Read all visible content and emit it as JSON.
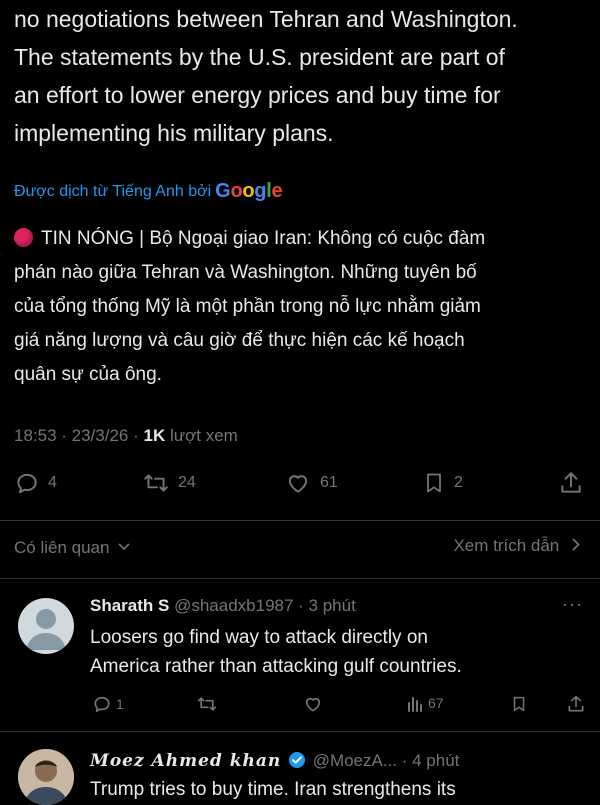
{
  "tweet": {
    "text_lines": [
      "no negotiations between Tehran and Washington.",
      "The statements by the U.S. president are part of",
      "an effort to lower energy prices and buy time for",
      "implementing his military plans."
    ],
    "translated_label": "Được dịch từ Tiếng Anh bởi",
    "translator_logo": [
      "G",
      "o",
      "o",
      "g",
      "l",
      "e"
    ],
    "translated_lines": [
      "TIN NÓNG | Bộ Ngoại giao Iran: Không có cuộc đàm",
      "phán nào giữa Tehran và Washington. Những tuyên bố",
      "của tổng thống Mỹ là một phần trong nỗ lực nhằm giảm",
      "giá năng lượng và câu giờ để thực hiện các kế hoạch",
      "quân sự của ông."
    ],
    "time": "18:53 · 23/3/26 · ",
    "views_count": "1K",
    "views_label": "lượt xem",
    "replies": "4",
    "reposts": "24",
    "likes": "61",
    "bookmarks": "2"
  },
  "links": {
    "related": "Có liên quan",
    "quotes": "Xem trích dẫn"
  },
  "replies": [
    {
      "name": "Sharath S",
      "handle": "@shaadxb1987 · 3 phút",
      "text_lines": [
        "Loosers go find way to attack directly on",
        "America rather than attacking gulf countries."
      ],
      "reply_count": "1",
      "views": "67"
    },
    {
      "name": "Moez Ahmed khan",
      "handle": "@MoezA... · 4 phút",
      "text_lines": [
        "Trump tries to buy time. Iran strengthens its"
      ]
    }
  ],
  "colors": {
    "background": "#000000",
    "text": "#e7e9ea",
    "muted": "#71767b",
    "link": "#1d9bf0",
    "verified": "#1d9bf0",
    "breaking_dot": "#e0245e"
  },
  "icons": {
    "reply": "reply-icon",
    "repost": "repost-icon",
    "like": "heart-icon",
    "bookmark": "bookmark-icon",
    "share": "share-icon",
    "views": "views-icon",
    "more": "more-icon",
    "chevron": "chevron-down-icon",
    "verified": "verified-badge-icon"
  }
}
